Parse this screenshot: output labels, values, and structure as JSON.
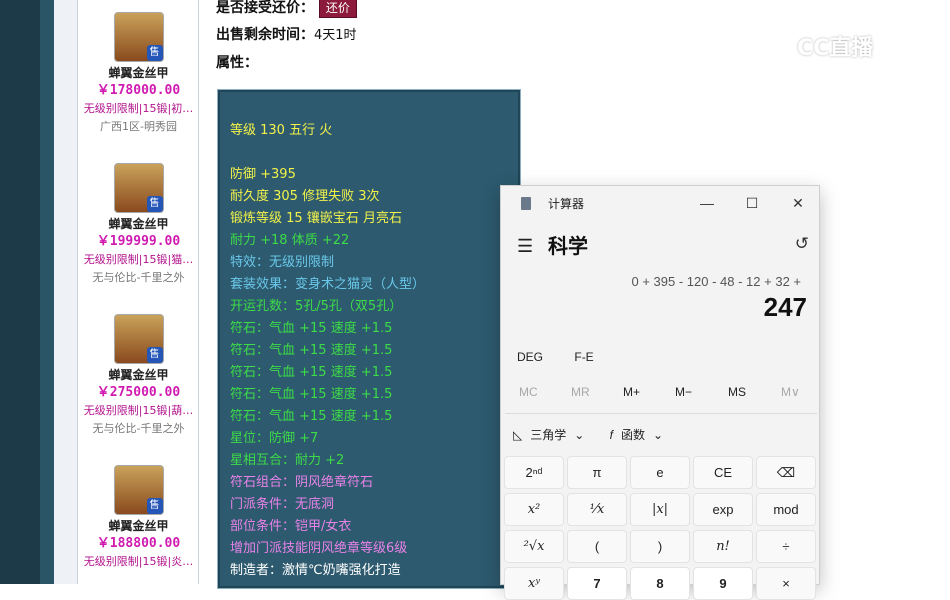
{
  "listing_items": [
    {
      "name": "蝉翼金丝甲",
      "price": "￥178000.00",
      "meta": "无级别限制|15锻|初…",
      "server": "广西1区-明秀园",
      "badge": "售"
    },
    {
      "name": "蝉翼金丝甲",
      "price": "￥199999.00",
      "meta": "无级别限制|15锻|猫…",
      "server": "无与伦比-千里之外",
      "badge": "售"
    },
    {
      "name": "蝉翼金丝甲",
      "price": "￥275000.00",
      "meta": "无级别限制|15锻|葫…",
      "server": "无与伦比-千里之外",
      "badge": "售"
    },
    {
      "name": "蝉翼金丝甲",
      "price": "￥188800.00",
      "meta": "无级别限制|15锻|炎…",
      "server": "",
      "badge": "售"
    }
  ],
  "detail": {
    "accept_haggle_label": "是否接受还价：",
    "haggle_button": "还价",
    "remaining_label": "出售剩余时间：",
    "remaining_value": "4天1时",
    "attributes_label": "属性："
  },
  "attributes": {
    "header": "等级 130 五行 火",
    "lines": [
      {
        "text": "防御 +395",
        "color": "#f2f24a"
      },
      {
        "text": "耐久度 305 修理失败 3次",
        "color": "#f2f24a"
      },
      {
        "text": "锻炼等级 15 镶嵌宝石 月亮石",
        "color": "#f2f24a"
      },
      {
        "text": "耐力 +18 体质 +22",
        "color": "#3ddc48"
      },
      {
        "text": "特效：无级别限制",
        "color": "#6ac8ea"
      },
      {
        "text": "套装效果：变身术之猫灵（人型）",
        "color": "#6ac8ea"
      },
      {
        "text": "开运孔数：5孔/5孔（双5孔）",
        "color": "#3ddc48"
      },
      {
        "text": "符石：气血 +15 速度 +1.5",
        "color": "#3ddc48"
      },
      {
        "text": "符石：气血 +15 速度 +1.5",
        "color": "#3ddc48"
      },
      {
        "text": "符石：气血 +15 速度 +1.5",
        "color": "#3ddc48"
      },
      {
        "text": "符石：气血 +15 速度 +1.5",
        "color": "#3ddc48"
      },
      {
        "text": "符石：气血 +15 速度 +1.5",
        "color": "#3ddc48"
      },
      {
        "text": "星位：防御 +7",
        "color": "#3ddc48"
      },
      {
        "text": "星相互合：耐力 +2",
        "color": "#3ddc48"
      },
      {
        "text": "符石组合：阴风绝章符石",
        "color": "#e882e8"
      },
      {
        "text": "门派条件：无底洞",
        "color": "#e882e8"
      },
      {
        "text": "部位条件：铠甲/女衣",
        "color": "#e882e8"
      },
      {
        "text": "增加门派技能阴风绝章等级6级",
        "color": "#e882e8"
      },
      {
        "text": "制造者：激情℃奶嘴强化打造",
        "color": "#ffffff"
      }
    ]
  },
  "watermark": "CC直播",
  "calculator": {
    "title": "计算器",
    "mode": "科学",
    "expression": "0 + 395 - 120 - 48 - 12 + 32 +",
    "result": "247",
    "angle_modes": [
      "DEG",
      "F-E"
    ],
    "memory": [
      "MC",
      "MR",
      "M+",
      "M−",
      "MS",
      "M∨"
    ],
    "trig_label": "三角学",
    "func_label": "函数",
    "keys_row1": [
      "2ⁿᵈ",
      "π",
      "e",
      "CE",
      "⌫"
    ],
    "keys_row2": [
      "x²",
      "¹⁄x",
      "|x|",
      "exp",
      "mod"
    ],
    "keys_row3": [
      "²√x",
      "(",
      ")",
      "n!",
      "÷"
    ],
    "keys_row4": [
      "xʸ",
      "7",
      "8",
      "9",
      "×"
    ]
  }
}
